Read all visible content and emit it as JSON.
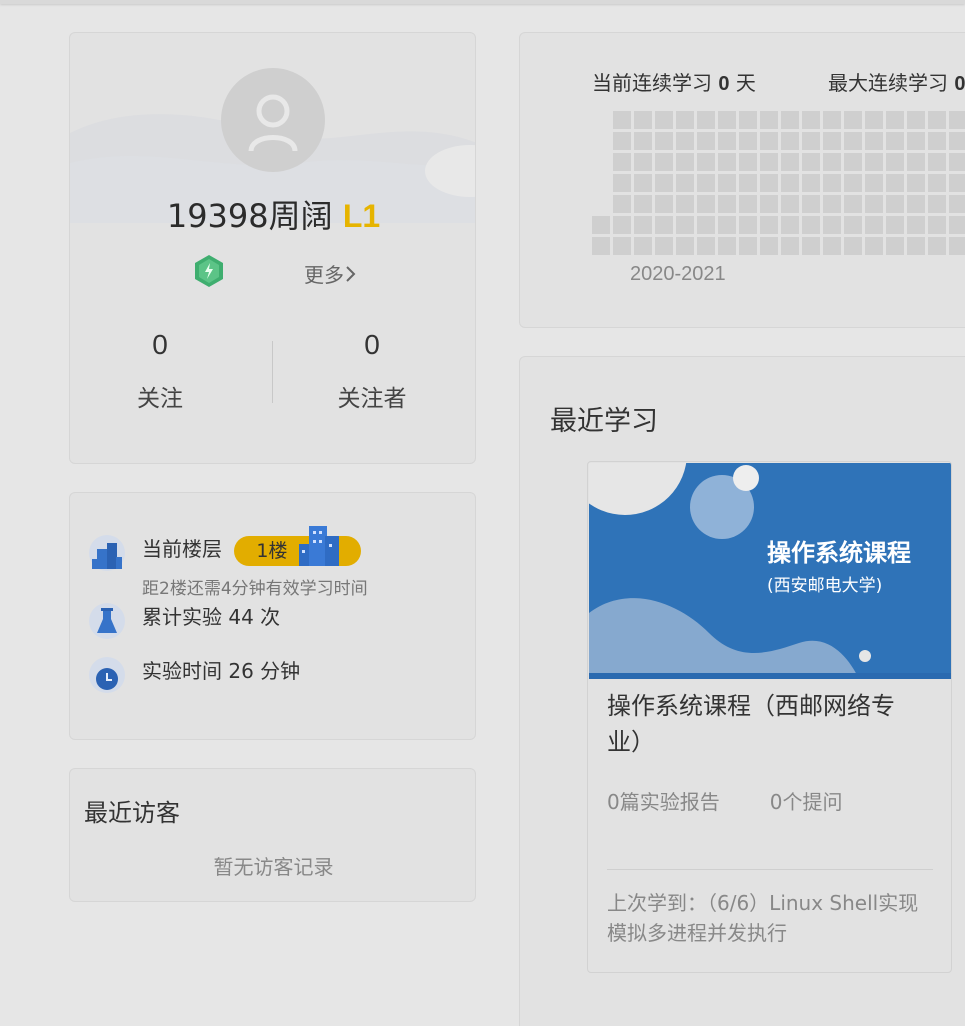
{
  "profile": {
    "username": "19398周阔",
    "level": "L1",
    "more_label": "更多",
    "following_count": "0",
    "following_label": "关注",
    "followers_count": "0",
    "followers_label": "关注者"
  },
  "floor": {
    "current_floor_label": "当前楼层",
    "current_floor_value": "1楼",
    "next_floor_hint": "距2楼还需4分钟有效学习时间",
    "experiments_text": "累计实验 44 次",
    "experiment_time_text": "实验时间 26 分钟"
  },
  "visitors": {
    "title": "最近访客",
    "empty_text": "暂无访客记录"
  },
  "heatmap": {
    "current_streak_label": "当前连续学习",
    "current_streak_value": "0",
    "current_streak_unit": "天",
    "max_streak_label": "最大连续学习",
    "max_streak_value": "0",
    "year_label": "2020-2021"
  },
  "recent": {
    "title": "最近学习",
    "course": {
      "cover_title": "操作系统课程",
      "cover_subtitle": "(西安邮电大学)",
      "name": "操作系统课程（西邮网络专业）",
      "reports": "0篇实验报告",
      "questions": "0个提问",
      "last_learned": "上次学到：（6/6）Linux Shell实现模拟多进程并发执行"
    }
  },
  "colors": {
    "level_accent": "#e6b400",
    "floor_pill": "#e2ad00",
    "cover_blue": "#2f73b8"
  }
}
